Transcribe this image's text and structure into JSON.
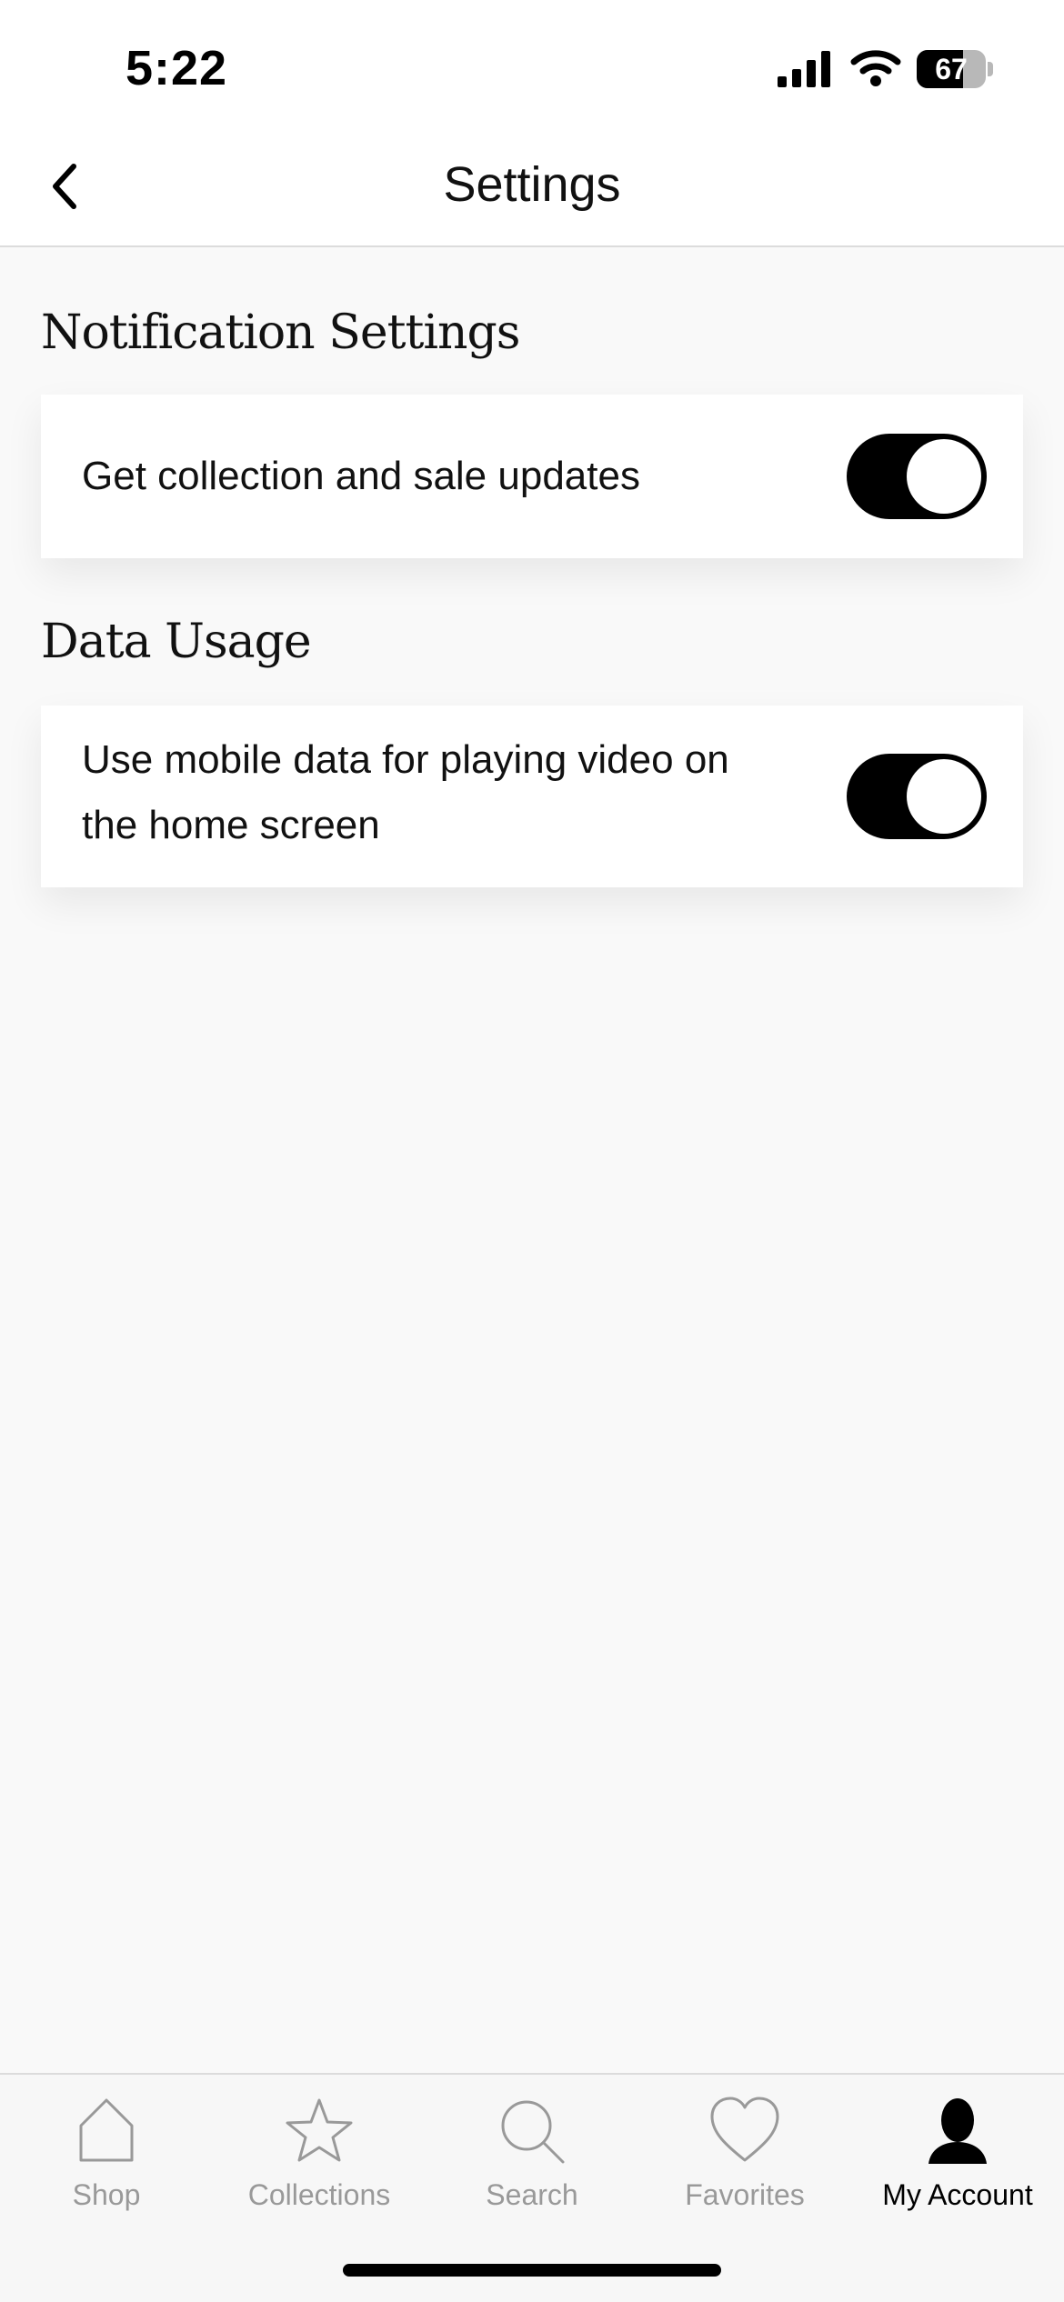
{
  "status_bar": {
    "time": "5:22",
    "battery_level": "67",
    "battery_fraction": 0.67
  },
  "nav": {
    "title": "Settings",
    "back_icon": "chevron-left-icon"
  },
  "sections": [
    {
      "heading": "Notification Settings",
      "rows": [
        {
          "label": "Get collection and sale updates",
          "toggle_on": true
        }
      ]
    },
    {
      "heading": "Data Usage",
      "rows": [
        {
          "label_line1": "Use mobile data for playing video on",
          "label_line2": "the home screen",
          "toggle_on": true
        }
      ]
    }
  ],
  "tab_bar": {
    "tabs": [
      {
        "label": "Shop",
        "icon": "home-icon",
        "active": false
      },
      {
        "label": "Collections",
        "icon": "star-icon",
        "active": false
      },
      {
        "label": "Search",
        "icon": "search-icon",
        "active": false
      },
      {
        "label": "Favorites",
        "icon": "heart-icon",
        "active": false
      },
      {
        "label": "My Account",
        "icon": "person-icon",
        "active": true
      }
    ]
  },
  "colors": {
    "background": "#f9f9f9",
    "card": "#ffffff",
    "toggle_on": "#000000",
    "tab_inactive": "#999999",
    "tab_active": "#000000"
  }
}
